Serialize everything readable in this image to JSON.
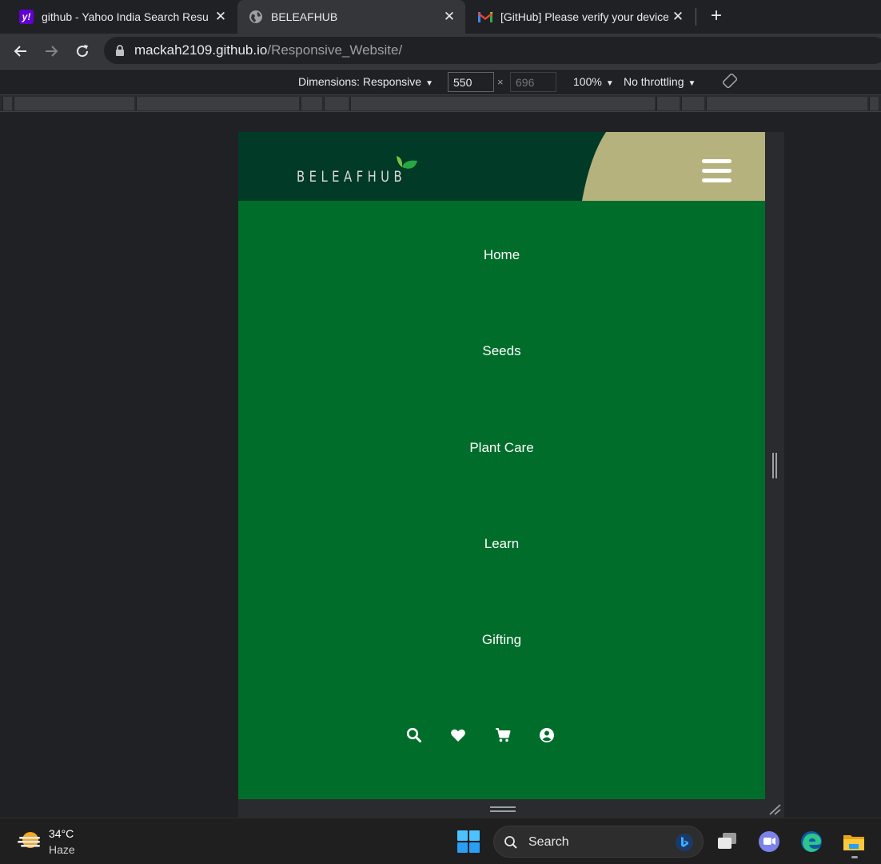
{
  "browser": {
    "tabs": [
      {
        "title": "github - Yahoo India Search Resu",
        "favicon": "yahoo-icon",
        "active": false
      },
      {
        "title": "BELEAFHUB",
        "favicon": "globe-icon",
        "active": true
      },
      {
        "title": "[GitHub] Please verify your device",
        "favicon": "gmail-icon",
        "active": false
      }
    ],
    "new_tab_label": "+",
    "close_glyph": "✕",
    "url_host": "mackah2109.github.io",
    "url_path": "/Responsive_Website/"
  },
  "devtools": {
    "dimensions_label": "Dimensions: Responsive",
    "width": "550",
    "height_placeholder": "696",
    "times": "×",
    "zoom": "100%",
    "throttling": "No throttling"
  },
  "site": {
    "logo_text": "BELEAFHUB",
    "menu_items": [
      "Home",
      "Seeds",
      "Plant Care",
      "Learn",
      "Gifting"
    ],
    "icons": [
      "search-icon",
      "heart-icon",
      "cart-icon",
      "user-icon"
    ],
    "colors": {
      "header_bg": "#013a26",
      "header_accent": "#b5b27e",
      "menu_bg": "#006d2a",
      "menu_text": "#ffffff"
    }
  },
  "taskbar": {
    "temperature": "34°C",
    "condition": "Haze",
    "search_label": "Search"
  }
}
